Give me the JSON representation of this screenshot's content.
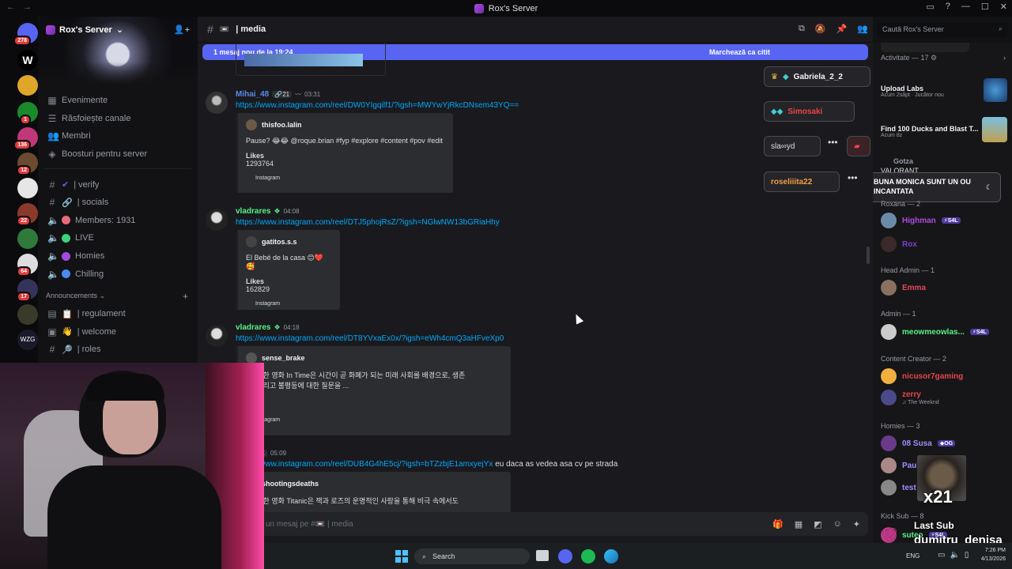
{
  "window": {
    "title": "Rox's Server"
  },
  "server": {
    "name": "Rox's Server",
    "search_placeholder": "Caută Rox's Server"
  },
  "guild_badges": [
    "278",
    "1",
    "136",
    "12",
    "22",
    "64",
    "17"
  ],
  "sidebar": {
    "top_items": [
      {
        "label": "Evenimente"
      },
      {
        "label": "Răsfoiește canale"
      },
      {
        "label": "Membri"
      },
      {
        "label": "Boosturi pentru server"
      }
    ],
    "channels": [
      {
        "label": "| verify"
      },
      {
        "label": "| socials"
      },
      {
        "label": "Members: 1931"
      },
      {
        "label": "LIVE"
      },
      {
        "label": "Homies"
      },
      {
        "label": "Chilling"
      }
    ],
    "category": "Announcements",
    "announce_channels": [
      {
        "label": "| regulament"
      },
      {
        "label": "| welcome"
      },
      {
        "label": "| roles"
      }
    ]
  },
  "channel": {
    "name": "| media",
    "input_placeholder": "un mesaj pe #📼 | media"
  },
  "new_messages": {
    "text": "1 mesaj nou de la 19:24",
    "action": "Marchează ca citit"
  },
  "messages": [
    {
      "user": "Mihai_48",
      "tag": "21",
      "time": "03:31",
      "link": "https://www.instagram.com/reel/DW0YIgqilf1/?igsh=MWYwYjRkcDNsem43YQ==",
      "embed": {
        "author": "thisfoo.lalin",
        "desc": "Pause? 😂😂 @roque.brian #fyp #explore #content #pov #edit",
        "field": "Likes",
        "value": "1293764",
        "footer": "Instagram"
      }
    },
    {
      "user": "vladrares",
      "time": "04:08",
      "link": "https://www.instagram.com/reel/DTJ5phojRsZ/?igsh=NGlwNW13bGRiaHhy",
      "embed": {
        "author": "gatitos.s.s",
        "desc": "El Bebé de la casa 😊❤️🥰",
        "field": "Likes",
        "value": "162829",
        "footer": "Instagram"
      }
    },
    {
      "user": "vladrares",
      "time": "04:18",
      "link": "https://www.instagram.com/reel/DT8YVxaEx0x/?igsh=eWh4cmQ3aHFveXp0",
      "embed": {
        "author": "sense_brake",
        "desc": "! 개봉한 영화 In Time은 시간이 곧 화폐가 되는 미래 사회를 배경으로, 생존",
        "desc2": "장, 그리고 불평등에 대한 질문을 ...",
        "value": "75",
        "footer": "Instagram"
      }
    },
    {
      "user": "48",
      "tag": "21",
      "time": "05:09",
      "link": "https://www.instagram.com/reel/DUB4G4hE5cj/?igsh=bTZzbjE1amxyejYx",
      "tail": "eu daca as vedea asa cv pe strada",
      "embed": {
        "author": "shootingsdeaths",
        "desc": "! 개봉한 영화 Titanic은 잭과 로즈의 운명적인 사랑을 통해 비극 속에서도"
      }
    }
  ],
  "members_panel": {
    "activity_header": "Activitate — 17",
    "activities": [
      {
        "name": "Upload Labs",
        "sub": "Acum 2săpt · Jucător nou"
      },
      {
        "name": "Find 100 Ducks and Blast T...",
        "sub": "Acum 8z"
      },
      {
        "name": "Gotza",
        "sub": "VALORANT"
      }
    ],
    "sections": [
      {
        "header": "Roxana — 2",
        "members": [
          {
            "name": "Highman",
            "badge": "S4L",
            "color": "#b04ae0"
          },
          {
            "name": "Rox",
            "color": "#7b3fd6"
          }
        ]
      },
      {
        "header": "Head Admin — 1",
        "members": [
          {
            "name": "Emma",
            "color": "#e04a5a"
          }
        ]
      },
      {
        "header": "Admin — 1",
        "members": [
          {
            "name": "meowmeowlas...",
            "badge": "S4L",
            "color": "#57f287"
          }
        ]
      },
      {
        "header": "Content Creator — 2",
        "members": [
          {
            "name": "nicusor7gaming",
            "color": "#e8454a"
          },
          {
            "name": "zerry",
            "sub": "The Weeknd",
            "color": "#e8454a"
          }
        ]
      },
      {
        "header": "Homies — 3",
        "members": [
          {
            "name": "08 Susa",
            "badge": "OG",
            "color": "#a48bff"
          },
          {
            "name": "Paul",
            "color": "#a48bff"
          },
          {
            "name": "test",
            "color": "#a48bff"
          }
        ]
      },
      {
        "header": "Kick Sub — 8",
        "members": [
          {
            "name": "suteo",
            "badge": "S4L",
            "color": "#57f287"
          }
        ]
      }
    ]
  },
  "overlay": {
    "pills": [
      "Gabriela_2_2",
      "Simosaki",
      "sla∞yd",
      "roseliiita22"
    ],
    "chat_message": "BUNA MONICA SUNT UN OU INCANTATA",
    "sub_count": "x21",
    "last_sub_label": "Last Sub",
    "last_sub_user": "dumitru_denisa"
  },
  "taskbar": {
    "search": "Search",
    "lang": "ENG",
    "time": "7:26 PM",
    "date": "4/13/2026"
  }
}
